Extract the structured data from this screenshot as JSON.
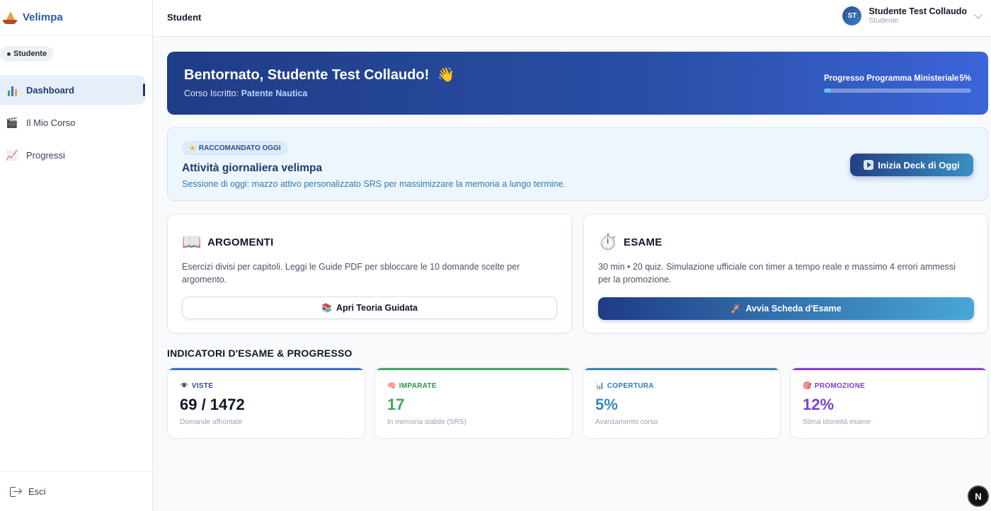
{
  "app": {
    "name": "Velimpa"
  },
  "sidebar": {
    "role_badge": "Studente",
    "items": [
      {
        "label": "Dashboard",
        "icon": "bar-chart-icon",
        "active": true
      },
      {
        "label": "Il Mio Corso",
        "icon": "clapper-icon"
      },
      {
        "label": "Progressi",
        "icon": "trend-chart-icon"
      }
    ],
    "logout_label": "Esci"
  },
  "header": {
    "title": "Student",
    "user": {
      "initials": "ST",
      "name": "Studente Test Collaudo",
      "role": "Studente"
    }
  },
  "hero": {
    "greeting": "Bentornato, Studente Test Collaudo!",
    "wave": "👋",
    "course_prefix": "Corso Iscritto:",
    "course_name": "Patente Nautica",
    "progress_label": "Progresso Programma Ministeriale",
    "progress_value": "5%",
    "progress_fraction": 0.05
  },
  "daily": {
    "badge": "RACCOMANDATO OGGI",
    "title": "Attività giornaliera velimpa",
    "description": "Sessione di oggi: mazzo attivo personalizzato SRS per massimizzare la memoria a lungo termine.",
    "button_label": "Inizia Deck di Oggi"
  },
  "cards": {
    "topics": {
      "icon": "📖",
      "title": "ARGOMENTI",
      "description": "Esercizi divisi per capitoli. Leggi le Guide PDF per sbloccare le 10 domande scelte per argomento.",
      "button_emoji": "📚",
      "button_label": "Apri Teoria Guidata"
    },
    "exam": {
      "icon": "⏱️",
      "title": "ESAME",
      "description": "30 min • 20 quiz. Simulazione ufficiale con timer a tempo reale e massimo 4 errori ammessi per la promozione.",
      "button_emoji": "🚀",
      "button_label": "Avvia Scheda d'Esame"
    }
  },
  "indicators": {
    "title": "INDICATORI D'ESAME & PROGRESSO",
    "stats": [
      {
        "icon": "👁️",
        "label": "VISTE",
        "value": "69 / 1472",
        "sub": "Domande affrontate",
        "accent": "#3b6fd4",
        "label_color": "#2b4f8f",
        "value_color": "#111827"
      },
      {
        "icon": "🧠",
        "label": "IMPARATE",
        "value": "17",
        "sub": "In memoria stabile (SRS)",
        "accent": "#3fa65a",
        "label_color": "#2f8f4a",
        "value_color": "#3fa65a"
      },
      {
        "icon": "📊",
        "label": "COPERTURA",
        "value": "5%",
        "sub": "Avanzamento corso",
        "accent": "#3b86b0",
        "label_color": "#2f7ab8",
        "value_color": "#2f8ab8"
      },
      {
        "icon": "🎯",
        "label": "PROMOZIONE",
        "value": "12%",
        "sub": "Stima idoneità esame",
        "accent": "#8b3fd9",
        "label_color": "#7c3fd0",
        "value_color": "#7c3fd0"
      }
    ]
  },
  "dev_badge": "N"
}
